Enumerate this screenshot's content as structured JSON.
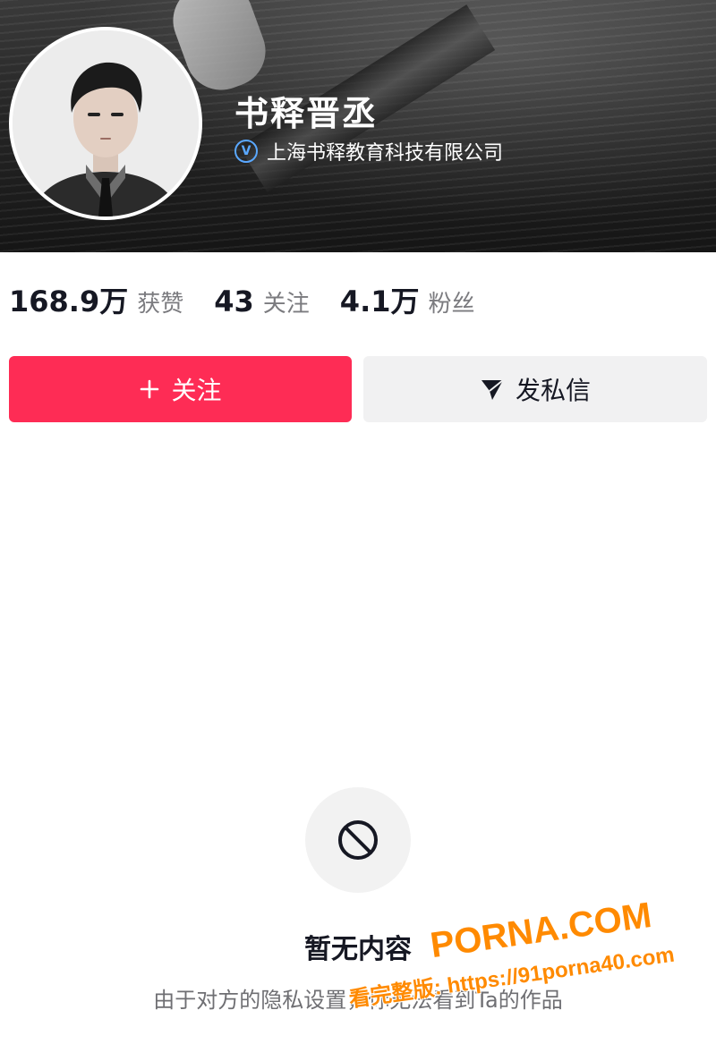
{
  "profile": {
    "name": "书释晋丞",
    "verified_icon": "verified-v-icon",
    "verified_text": "上海书释教育科技有限公司",
    "avatar_icon": "avatar-portrait"
  },
  "stats": [
    {
      "value": "168.9万",
      "label": "获赞"
    },
    {
      "value": "43",
      "label": "关注"
    },
    {
      "value": "4.1万",
      "label": "粉丝"
    }
  ],
  "actions": {
    "follow_label": "关注",
    "follow_icon": "plus-icon",
    "message_label": "发私信",
    "message_icon": "send-icon"
  },
  "empty_state": {
    "icon": "no-entry-icon",
    "title": "暂无内容",
    "description": "由于对方的隐私设置，你无法看到Ta的作品"
  },
  "watermark": {
    "main": "PORNA.COM",
    "url": "看完整版: https://91porna40.com"
  },
  "colors": {
    "accent": "#fe2c55",
    "secondary_button": "#f1f1f2",
    "verified": "#5aa8ff",
    "watermark": "#ff8a00"
  }
}
